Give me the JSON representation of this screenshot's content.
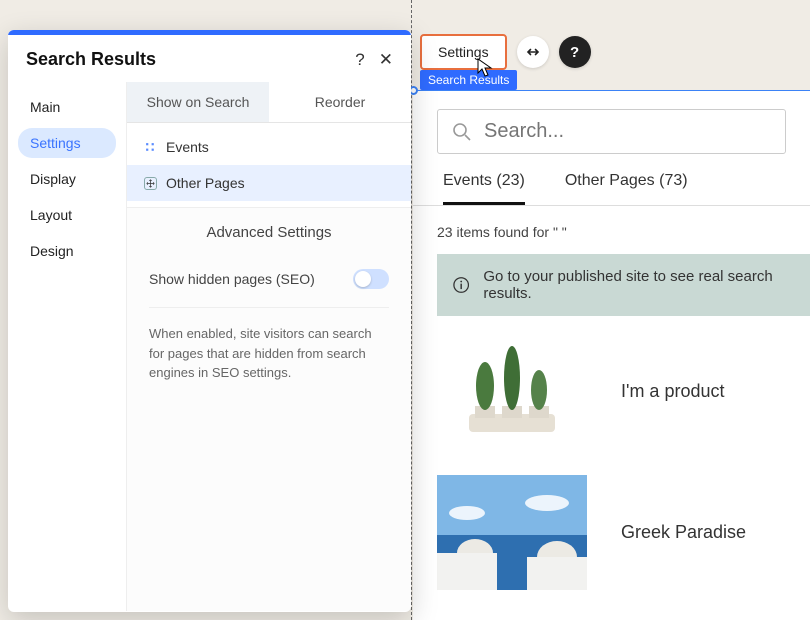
{
  "panel": {
    "title": "Search Results",
    "nav": [
      "Main",
      "Settings",
      "Display",
      "Layout",
      "Design"
    ],
    "nav_active": 1,
    "tabs": [
      "Show on Search",
      "Reorder"
    ],
    "tab_active": 0,
    "list": [
      "Events",
      "Other Pages"
    ],
    "advanced_header": "Advanced Settings",
    "hidden_label": "Show hidden pages (SEO)",
    "hidden_on": false,
    "help": "When enabled, site visitors can search for pages that are hidden from search engines in SEO settings."
  },
  "context": {
    "settings_label": "Settings",
    "tag": "Search Results"
  },
  "preview": {
    "search_placeholder": "Search...",
    "tabs": [
      {
        "label": "Events",
        "count": 23
      },
      {
        "label": "Other Pages",
        "count": 73
      }
    ],
    "tab_active": 0,
    "count_text": "23 items found for \" \"",
    "banner": "Go to your published site to see real search results.",
    "results": [
      {
        "title": "I'm a product",
        "thumb": "cactus"
      },
      {
        "title": "Greek Paradise",
        "thumb": "santorini"
      }
    ]
  }
}
